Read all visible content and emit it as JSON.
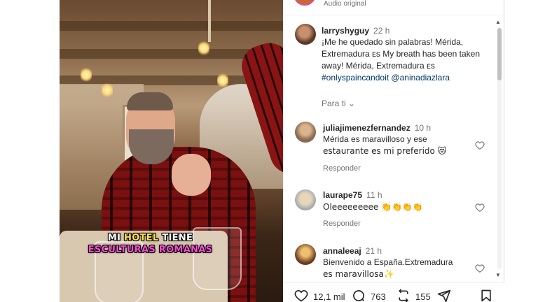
{
  "post": {
    "audio_label": "Audio original"
  },
  "video": {
    "caption_line1_a": "MI ",
    "caption_line1_hl": "HOTEL",
    "caption_line1_b": " TIENE",
    "caption_line2": "ESCULTURAS ROMANAS"
  },
  "caption_comment": {
    "username": "larryshyguy",
    "time": "22 h",
    "text": "¡Me he quedado sin palabras! Mérida, Extremadura ᴇs My breath has been taken away! Mérida, Extremadura ᴇs",
    "hashtag": "#onlyspaincandoit",
    "mention": "@aninadiazlara",
    "translate": "Para ti"
  },
  "comments": [
    {
      "username": "juliajimenezfernandez",
      "time": "10 h",
      "line1": "Mérida es maravilloso y ese",
      "line2": "estaurante es mi preferido 😻",
      "reply": "Responder"
    },
    {
      "username": "laurape75",
      "time": "11 h",
      "line1": "Oleeeeeeeee 👏👏👏👏",
      "reply": "Responder"
    },
    {
      "username": "annaleeaj",
      "time": "21 h",
      "line1": "Bienvenido a España.Extremadura",
      "line2": "es maravillosa✨"
    }
  ],
  "actions": {
    "likes": "12,1 mil",
    "comments": "763",
    "reposts": "155"
  },
  "colors": {
    "link": "#00376b",
    "caption_highlight": "#ffe34a",
    "caption_pink": "#ff4bd6"
  }
}
